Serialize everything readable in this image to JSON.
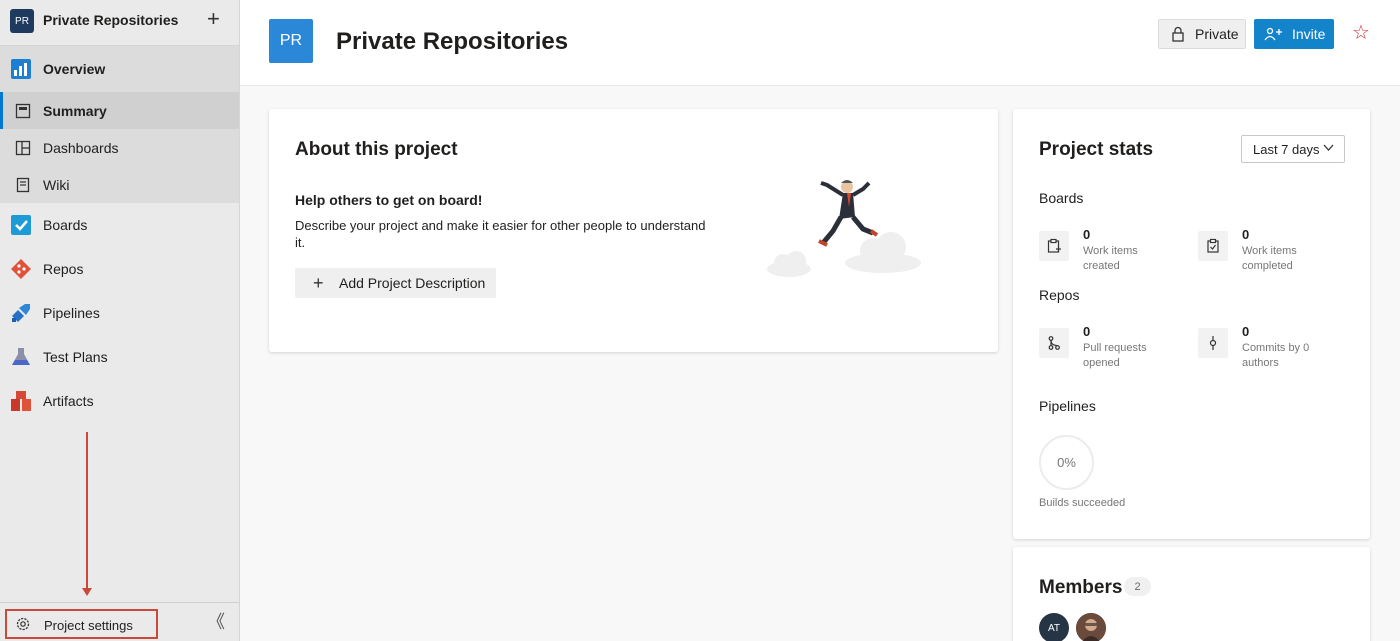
{
  "sidebar": {
    "project_initials": "PR",
    "project_name": "Private Repositories",
    "overview": "Overview",
    "sub_items": [
      {
        "label": "Summary"
      },
      {
        "label": "Dashboards"
      },
      {
        "label": "Wiki"
      }
    ],
    "main_items": [
      {
        "label": "Boards"
      },
      {
        "label": "Repos"
      },
      {
        "label": "Pipelines"
      },
      {
        "label": "Test Plans"
      },
      {
        "label": "Artifacts"
      }
    ],
    "project_settings": "Project settings",
    "collapse_glyph": "《"
  },
  "header": {
    "initials": "PR",
    "title": "Private Repositories",
    "private_label": "Private",
    "invite_label": "Invite",
    "star_glyph": "☆"
  },
  "about": {
    "title": "About this project",
    "help_heading": "Help others to get on board!",
    "description": "Describe your project and make it easier for other people to understand it.",
    "add_button": "Add Project Description"
  },
  "stats": {
    "title": "Project stats",
    "range": "Last 7 days",
    "boards_heading": "Boards",
    "boards": [
      {
        "value": "0",
        "caption": "Work items created"
      },
      {
        "value": "0",
        "caption": "Work items completed"
      }
    ],
    "repos_heading": "Repos",
    "repos": [
      {
        "value": "0",
        "caption": "Pull requests opened"
      },
      {
        "value": "0",
        "caption": "Commits by 0 authors"
      }
    ],
    "pipelines_heading": "Pipelines",
    "pipelines_value": "0%",
    "pipelines_caption": "Builds succeeded"
  },
  "members": {
    "title": "Members",
    "count": "2",
    "first_initials": "AT"
  },
  "colors": {
    "accent": "#1384c9",
    "highlight": "#c94a3b"
  }
}
